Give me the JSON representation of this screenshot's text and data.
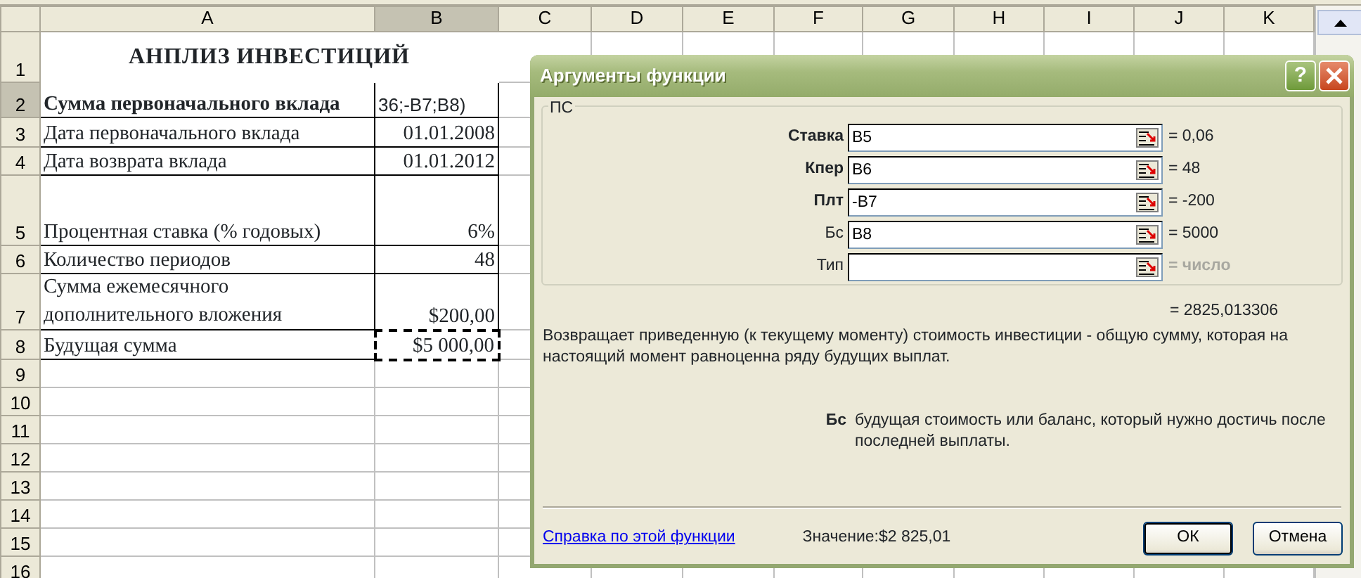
{
  "sheet": {
    "columns": [
      {
        "label": "A",
        "selected": false
      },
      {
        "label": "B",
        "selected": true
      },
      {
        "label": "C",
        "selected": false
      },
      {
        "label": "D",
        "selected": false
      },
      {
        "label": "E",
        "selected": false
      },
      {
        "label": "F",
        "selected": false
      },
      {
        "label": "G",
        "selected": false
      },
      {
        "label": "H",
        "selected": false
      },
      {
        "label": "I",
        "selected": false
      },
      {
        "label": "J",
        "selected": false
      },
      {
        "label": "K",
        "selected": false
      }
    ],
    "rows": [
      {
        "header": "1",
        "selected": false,
        "kind": "title",
        "a": "АНПЛИЗ ИНВЕСТИЦИЙ"
      },
      {
        "header": "2",
        "selected": true,
        "kind": "bold",
        "a": "Сумма первоначального вклада",
        "b": "36;-B7;B8)",
        "marquee": false
      },
      {
        "header": "3",
        "selected": false,
        "kind": "normal",
        "a": "Дата первоначального вклада",
        "b": "01.01.2008",
        "marquee": false
      },
      {
        "header": "4",
        "selected": false,
        "kind": "normal",
        "a": "Дата возврата вклада",
        "b": "01.01.2012",
        "marquee": false
      },
      {
        "header": "5",
        "selected": false,
        "kind": "normal",
        "a": "Процентная ставка (% годовых)",
        "b": "6%",
        "marquee": false
      },
      {
        "header": "6",
        "selected": false,
        "kind": "normal",
        "a": "Количество периодов",
        "b": "48",
        "marquee": false
      },
      {
        "header": "7",
        "selected": false,
        "kind": "normal",
        "a": "Сумма ежемесячного дополнительного вложения",
        "b": "$200,00",
        "marquee": false
      },
      {
        "header": "8",
        "selected": false,
        "kind": "normal",
        "a": "Будущая сумма",
        "b": "$5 000,00",
        "marquee": true
      },
      {
        "header": "9",
        "selected": false,
        "kind": "empty"
      },
      {
        "header": "10",
        "selected": false,
        "kind": "empty"
      },
      {
        "header": "11",
        "selected": false,
        "kind": "empty"
      },
      {
        "header": "12",
        "selected": false,
        "kind": "empty"
      },
      {
        "header": "13",
        "selected": false,
        "kind": "empty"
      },
      {
        "header": "14",
        "selected": false,
        "kind": "empty"
      },
      {
        "header": "15",
        "selected": false,
        "kind": "empty"
      },
      {
        "header": "16",
        "selected": false,
        "kind": "empty"
      }
    ]
  },
  "dialog": {
    "title": "Аргументы функции",
    "help_button": "?",
    "group": "ПС",
    "arguments": [
      {
        "label": "Ставка",
        "required": true,
        "value": "B5",
        "result": "= 0,06",
        "greyed": false
      },
      {
        "label": "Кпер",
        "required": true,
        "value": "B6",
        "result": "= 48",
        "greyed": false
      },
      {
        "label": "Плт",
        "required": true,
        "value": "-B7",
        "result": "= -200",
        "greyed": false
      },
      {
        "label": "Бс",
        "required": false,
        "value": "B8",
        "result": "= 5000",
        "greyed": false
      },
      {
        "label": "Тип",
        "required": false,
        "result": "= число",
        "greyed": true
      }
    ],
    "formula_result": "= 2825,013306",
    "description": "Возвращает приведенную (к текущему моменту) стоимость инвестиции - общую сумму, которая на настоящий момент равноценна ряду будущих выплат.",
    "argument_help": {
      "name": "Бс",
      "text": "будущая стоимость или баланс, который нужно достичь после последней выплаты."
    },
    "help_link": "Справка по этой функции",
    "value_label": "Значение:",
    "value": "$2 825,01",
    "buttons": [
      {
        "label": "ОК",
        "default": true
      },
      {
        "label": "Отмена",
        "default": false
      }
    ]
  }
}
